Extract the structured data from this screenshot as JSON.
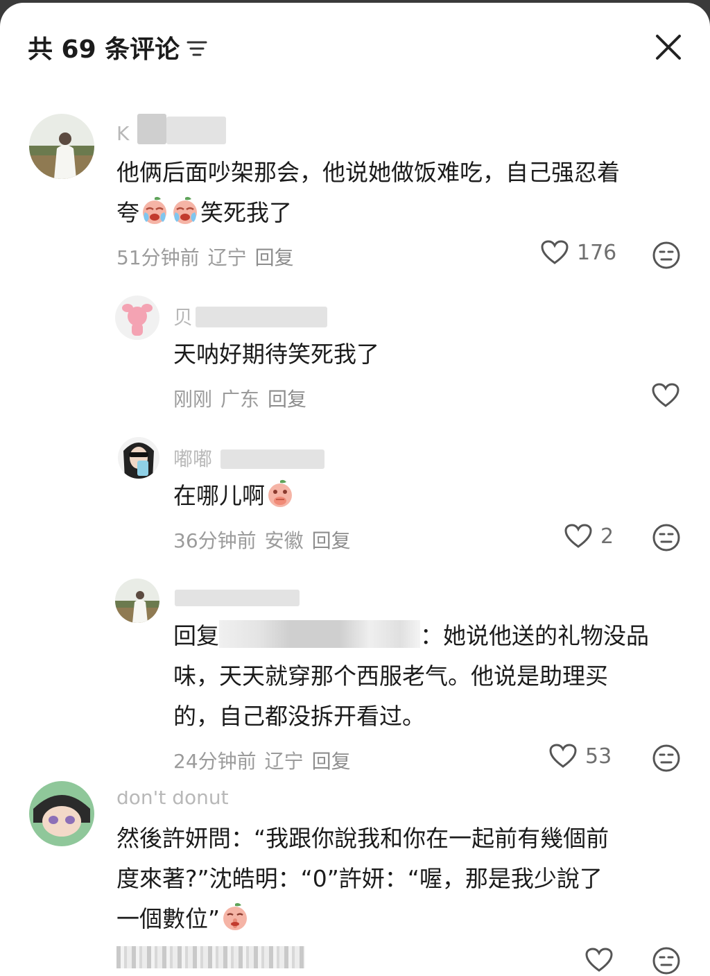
{
  "header": {
    "title": "共 69 条评论",
    "filter_icon": "filter-lines-icon",
    "close_icon": "close-icon"
  },
  "comments": [
    {
      "username": "K",
      "text_line1": "他俩后面吵架那会，他说她做饭难吃，自己强忍着",
      "text_line2": "夸",
      "text_line2_suffix": "笑死我了",
      "time": "51分钟前",
      "location": "辽宁",
      "reply_label": "回复",
      "likes": "176",
      "replies": [
        {
          "username": "贝",
          "text": "天呐好期待笑死我了",
          "time": "刚刚",
          "location": "广东",
          "reply_label": "回复",
          "likes": ""
        },
        {
          "username": "嘟嘟",
          "text": "在哪儿啊",
          "time": "36分钟前",
          "location": "安徽",
          "reply_label": "回复",
          "likes": "2"
        },
        {
          "username": "",
          "reply_prefix": "回复",
          "text_line1": "：她说他送的礼物没品",
          "text_line2": "味，天天就穿那个西服老气。他说是助理买",
          "text_line3": "的，自己都没拆开看过。",
          "time": "24分钟前",
          "location": "辽宁",
          "reply_label": "回复",
          "likes": "53"
        }
      ]
    },
    {
      "username": "don't donut",
      "text_line1": "然後許妍問：“我跟你說我和你在一起前有幾個前",
      "text_line2": "度來著?”沈皓明：“0”許妍：“喔，那是我少說了",
      "text_line3": "一個數位”",
      "likes": ""
    }
  ]
}
